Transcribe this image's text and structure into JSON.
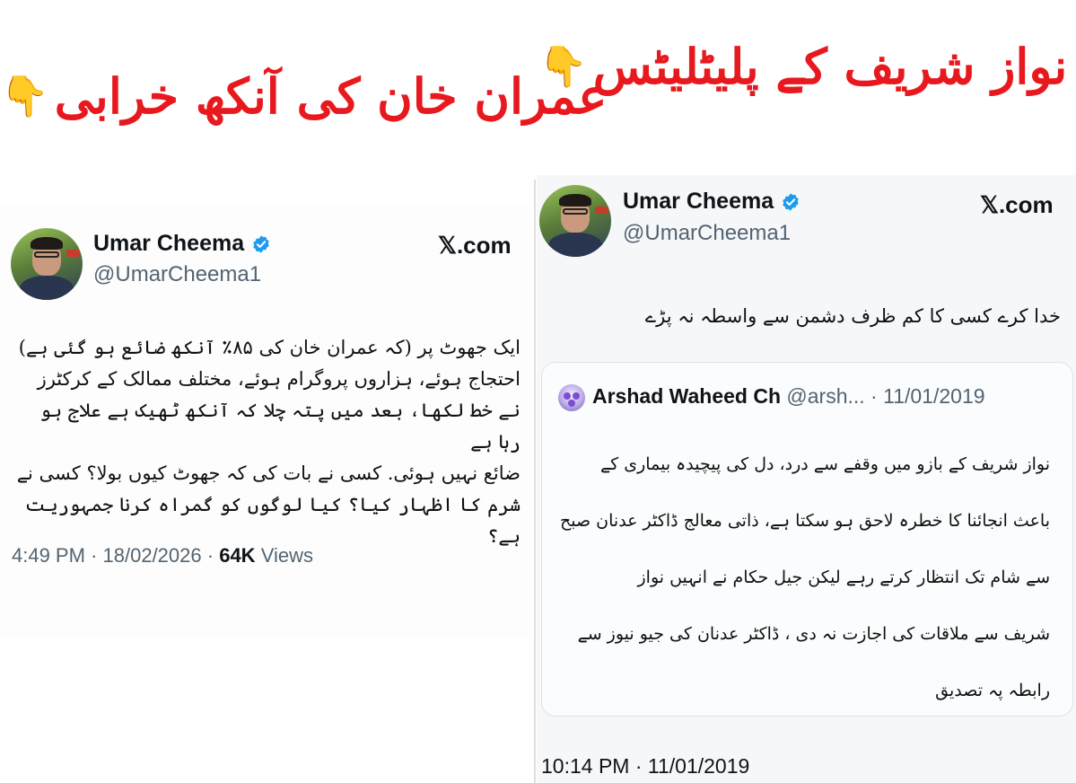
{
  "headlines": {
    "left": {
      "text": "عمران خان کی آنکھ خرابی",
      "emoji": "👇"
    },
    "right": {
      "text": "نواز شریف کے پلیٹلیٹس",
      "emoji": "👇"
    }
  },
  "colors": {
    "headline": "#e8191e",
    "verified": "#1d9bf0",
    "text": "#0f1419",
    "muted": "#536471"
  },
  "left_tweet": {
    "name": "Umar Cheema",
    "handle": "@UmarCheema1",
    "brand": "𝕏.com",
    "lines": [
      "ایک جھوٹ پر (کہ عمران خان کی ۸۵٪ آنکھ ضائع ہو گئی ہے)",
      "احتجاج ہوئے، ہزاروں پروگرام ہوئے، مختلف ممالک کے کرکٹرز",
      "نے خط لکھا، بعد میں پتہ چلا کہ آنکھ ٹھیک ہے علاج ہو رہا ہے",
      "ضائع نہیں ہوئی. کسی نے بات کی کہ جھوٹ کیوں بولا؟ کسی نے",
      "شرم کا اظہار کیا؟ کیا لوگوں کو گمراہ کرنا جمہوریت ہے؟"
    ],
    "time": "4:49 PM",
    "date": "18/02/2026",
    "views_count": "64K",
    "views_label": "Views"
  },
  "right_tweet": {
    "name": "Umar Cheema",
    "handle": "@UmarCheema1",
    "brand": "𝕏.com",
    "text": "خدا کرے کسی کا کم ظرف دشمن سے واسطہ نہ پڑے",
    "time": "10:14 PM",
    "date": "11/01/2019",
    "quote": {
      "name": "Arshad Waheed Ch",
      "handle": "@arsh...",
      "date": "11/01/2019",
      "lines": [
        "نواز شریف کے بازو میں وقفے سے درد، دل کی پیچیدہ بیماری کے",
        "باعث انجائنا کا خطرہ لاحق ہو سکتا ہے، ذاتی معالج ڈاکٹر عدنان صبح",
        "سے شام تک انتظار کرتے رہے لیکن جیل حکام نے انہیں نواز",
        "شریف سے ملاقات کی اجازت نہ دی ، ڈاکٹر عدنان کی جیو نیوز سے",
        "رابطہ پہ تصدیق"
      ]
    }
  }
}
